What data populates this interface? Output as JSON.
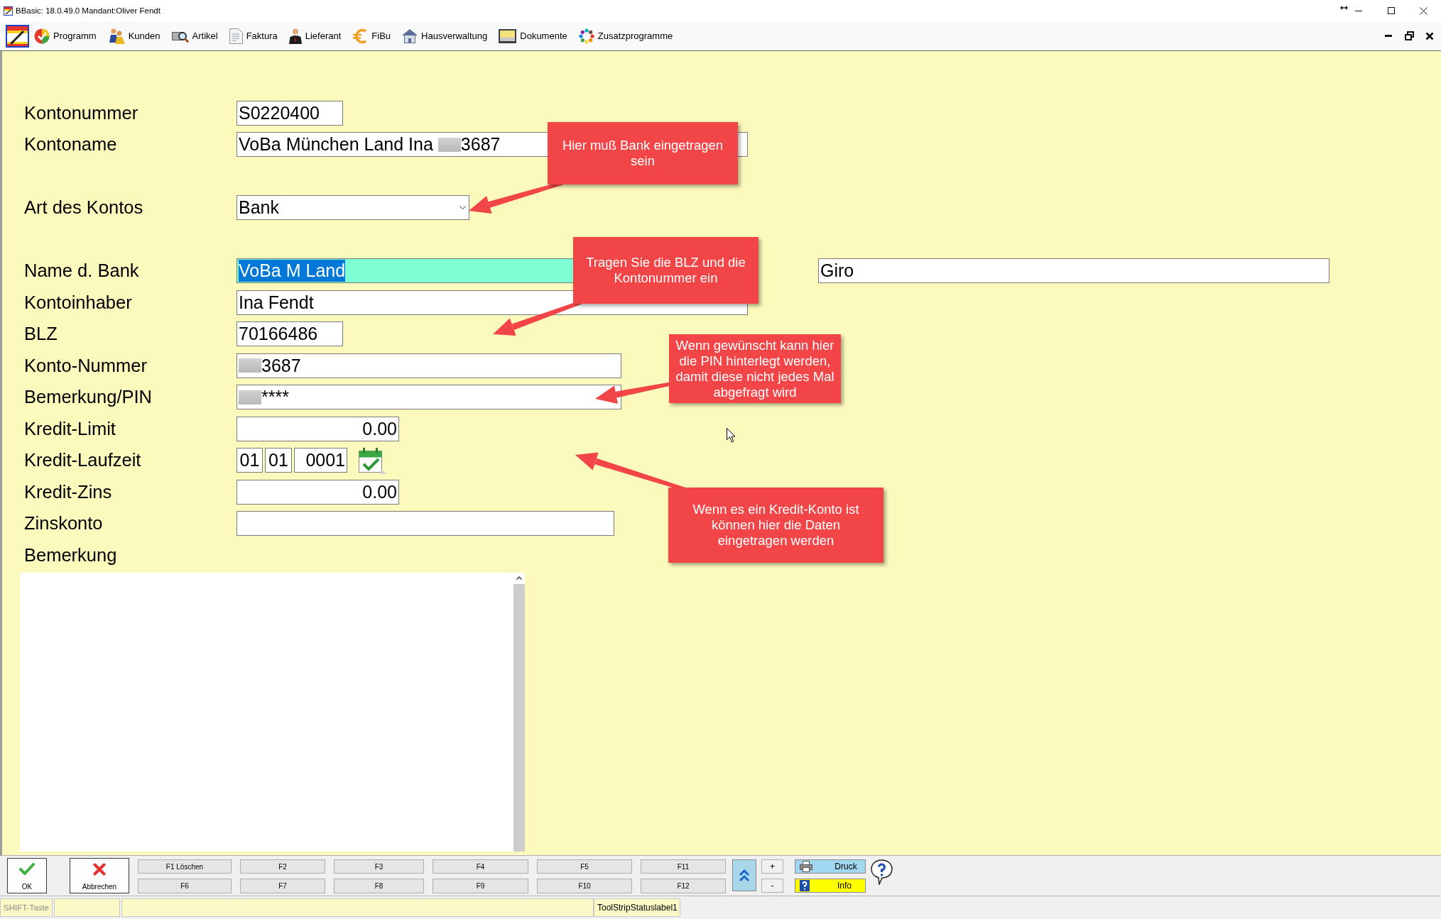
{
  "window": {
    "title": "BBasic: 18.0.49.0 Mandant:Oliver Fendt"
  },
  "menu": {
    "items": [
      {
        "label": "Programm"
      },
      {
        "label": "Kunden"
      },
      {
        "label": "Artikel"
      },
      {
        "label": "Faktura"
      },
      {
        "label": "Lieferant"
      },
      {
        "label": "FiBu"
      },
      {
        "label": "Hausverwaltung"
      },
      {
        "label": "Dokumente"
      },
      {
        "label": "Zusatzprogramme"
      }
    ]
  },
  "form": {
    "sections": [
      {
        "rows": [
          {
            "label": "Kontonummer",
            "fields": [
              {
                "kind": "text",
                "value": "S0220400",
                "focused": false
              }
            ]
          },
          {
            "label": "Kontoname",
            "fields": [
              {
                "kind": "text",
                "segments": [
                  {
                    "kind": "text",
                    "text": "VoBa München Land Ina"
                  },
                  {
                    "kind": "redaction"
                  },
                  {
                    "kind": "text",
                    "text": "3687"
                  }
                ],
                "focused": false
              }
            ]
          }
        ]
      },
      {
        "rows": [
          {
            "label": "Art des Kontos",
            "fields": [
              {
                "kind": "dropdown",
                "value": "Bank",
                "focused": false
              }
            ]
          }
        ]
      },
      {
        "rows": [
          {
            "label": "Name d. Bank",
            "fields": [
              {
                "kind": "text",
                "value": "VoBa M Land",
                "focused": true
              },
              {
                "kind": "text",
                "value": "Giro",
                "focused": false
              }
            ]
          },
          {
            "label": "Kontoinhaber",
            "fields": [
              {
                "kind": "text",
                "value": "Ina Fendt",
                "focused": false
              }
            ]
          },
          {
            "label": "BLZ",
            "fields": [
              {
                "kind": "text",
                "value": "70166486",
                "focused": false
              }
            ]
          },
          {
            "label": "Konto-Nummer",
            "fields": [
              {
                "kind": "text",
                "segments": [
                  {
                    "kind": "redaction"
                  },
                  {
                    "kind": "text",
                    "text": "3687"
                  }
                ],
                "focused": false
              }
            ]
          },
          {
            "label": "Bemerkung/PIN",
            "fields": [
              {
                "kind": "text",
                "segments": [
                  {
                    "kind": "redaction"
                  },
                  {
                    "kind": "text",
                    "text": "****"
                  }
                ],
                "focused": false
              }
            ]
          },
          {
            "label": "Kredit-Limit",
            "fields": [
              {
                "kind": "amount",
                "value": "0.00",
                "focused": false
              }
            ]
          },
          {
            "label": "Kredit-Laufzeit",
            "fields": [
              {
                "kind": "date",
                "day": "01",
                "month": "01",
                "year": "0001",
                "focused": false
              }
            ]
          },
          {
            "label": "Kredit-Zins",
            "fields": [
              {
                "kind": "amount",
                "value": "0.00",
                "focused": false
              }
            ]
          },
          {
            "label": "Zinskonto",
            "fields": [
              {
                "kind": "text",
                "focused": false
              }
            ]
          },
          {
            "label": "Bemerkung"
          }
        ]
      }
    ]
  },
  "annotations": [
    {
      "text": "Hier muß Bank eingetragen sein"
    },
    {
      "text": "Tragen Sie die BLZ und die Kontonummer ein"
    },
    {
      "text": "Wenn gewünscht kann hier die PIN hinterlegt werden, damit diese nicht jedes Mal abgefragt wird"
    },
    {
      "text": "Wenn es ein Kredit-Konto ist können hier die Daten eingetragen werden"
    }
  ],
  "bottom_bar": {
    "ok": {
      "label": "OK"
    },
    "cancel": {
      "label": "Abbrechen"
    },
    "function_key_rows": [
      [
        "F1 Löschen",
        "F2",
        "F3",
        "F4",
        "F5",
        "F11"
      ],
      [
        "F6",
        "F7",
        "F8",
        "F9",
        "F10",
        "F12"
      ]
    ],
    "step_buttons": [
      "+",
      "-"
    ],
    "print": {
      "label": "Druck"
    },
    "info": {
      "label": "Info"
    }
  },
  "status_bar": {
    "key_hint": "SHIFT-Taste",
    "label": "ToolStripStatuslabel1"
  }
}
